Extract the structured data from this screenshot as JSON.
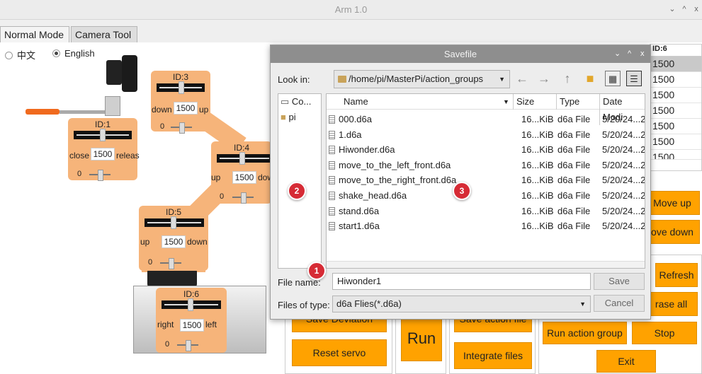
{
  "window": {
    "title": "Arm 1.0",
    "controls": [
      "⌄",
      "^",
      "x"
    ]
  },
  "tabs": [
    {
      "label": "Normal Mode",
      "active": true
    },
    {
      "label": "Camera Tool",
      "active": false
    }
  ],
  "language": {
    "options": [
      "中文",
      "English"
    ],
    "selected": "English"
  },
  "servos": [
    {
      "id": "ID:3",
      "left": "down",
      "right": "up",
      "value": "1500",
      "zero": "0"
    },
    {
      "id": "ID:1",
      "left": "close",
      "right": "releas",
      "value": "1500",
      "zero": "0"
    },
    {
      "id": "ID:4",
      "left": "up",
      "right": "dow",
      "value": "1500",
      "zero": "0"
    },
    {
      "id": "ID:5",
      "left": "up",
      "right": "down",
      "value": "1500",
      "zero": "0"
    },
    {
      "id": "ID:6",
      "left": "right",
      "right": "left",
      "value": "1500",
      "zero": "0"
    }
  ],
  "table": {
    "header": "ID:6",
    "values": [
      "1500",
      "1500",
      "1500",
      "1500",
      "1500",
      "1500",
      "1500"
    ]
  },
  "buttons": {
    "move_up": "Move up",
    "move_down": "ove down",
    "refresh": "Refresh",
    "erase_all": "rase all",
    "run_action_group": "Run action group",
    "stop": "Stop",
    "exit": "Exit",
    "run": "Run",
    "reset_servo": "Reset servo",
    "integrate_files": "Integrate files",
    "save_deviation": "Save Deviation",
    "save_action_file": "Save action file"
  },
  "dialog": {
    "title": "Savefile",
    "controls": [
      "⌄",
      "^",
      "x"
    ],
    "look_in_label": "Look in:",
    "look_in_path": "/home/pi/MasterPi/action_groups",
    "sidebar": [
      "Co...",
      "pi"
    ],
    "columns": [
      "Name",
      "Size",
      "Type",
      "Date Modi"
    ],
    "files": [
      {
        "name": "000.d6a",
        "size": "16...KiB",
        "type": "d6a File",
        "date": "5/20/24...2"
      },
      {
        "name": "1.d6a",
        "size": "16...KiB",
        "type": "d6a File",
        "date": "5/20/24...2"
      },
      {
        "name": "Hiwonder.d6a",
        "size": "16...KiB",
        "type": "d6a File",
        "date": "5/20/24...2"
      },
      {
        "name": "move_to_the_left_front.d6a",
        "size": "16...KiB",
        "type": "d6a File",
        "date": "5/20/24...2"
      },
      {
        "name": "move_to_the_right_front.d6a",
        "size": "16...KiB",
        "type": "d6a File",
        "date": "5/20/24...2"
      },
      {
        "name": "shake_head.d6a",
        "size": "16...KiB",
        "type": "d6a File",
        "date": "5/20/24...2"
      },
      {
        "name": "stand.d6a",
        "size": "16...KiB",
        "type": "d6a File",
        "date": "5/20/24...2"
      },
      {
        "name": "start1.d6a",
        "size": "16...KiB",
        "type": "d6a File",
        "date": "5/20/24...2"
      }
    ],
    "filename_label": "File name:",
    "filename_value": "Hiwonder1",
    "filetype_label": "Files of type:",
    "filetype_value": "d6a Flies(*.d6a)",
    "save_label": "Save",
    "cancel_label": "Cancel"
  },
  "markers": [
    "1",
    "2",
    "3"
  ],
  "colors": {
    "accent": "#ffa200",
    "servo_panel": "#f6b47a",
    "dialog_title": "#8e8e8e",
    "marker": "#d62b35"
  }
}
